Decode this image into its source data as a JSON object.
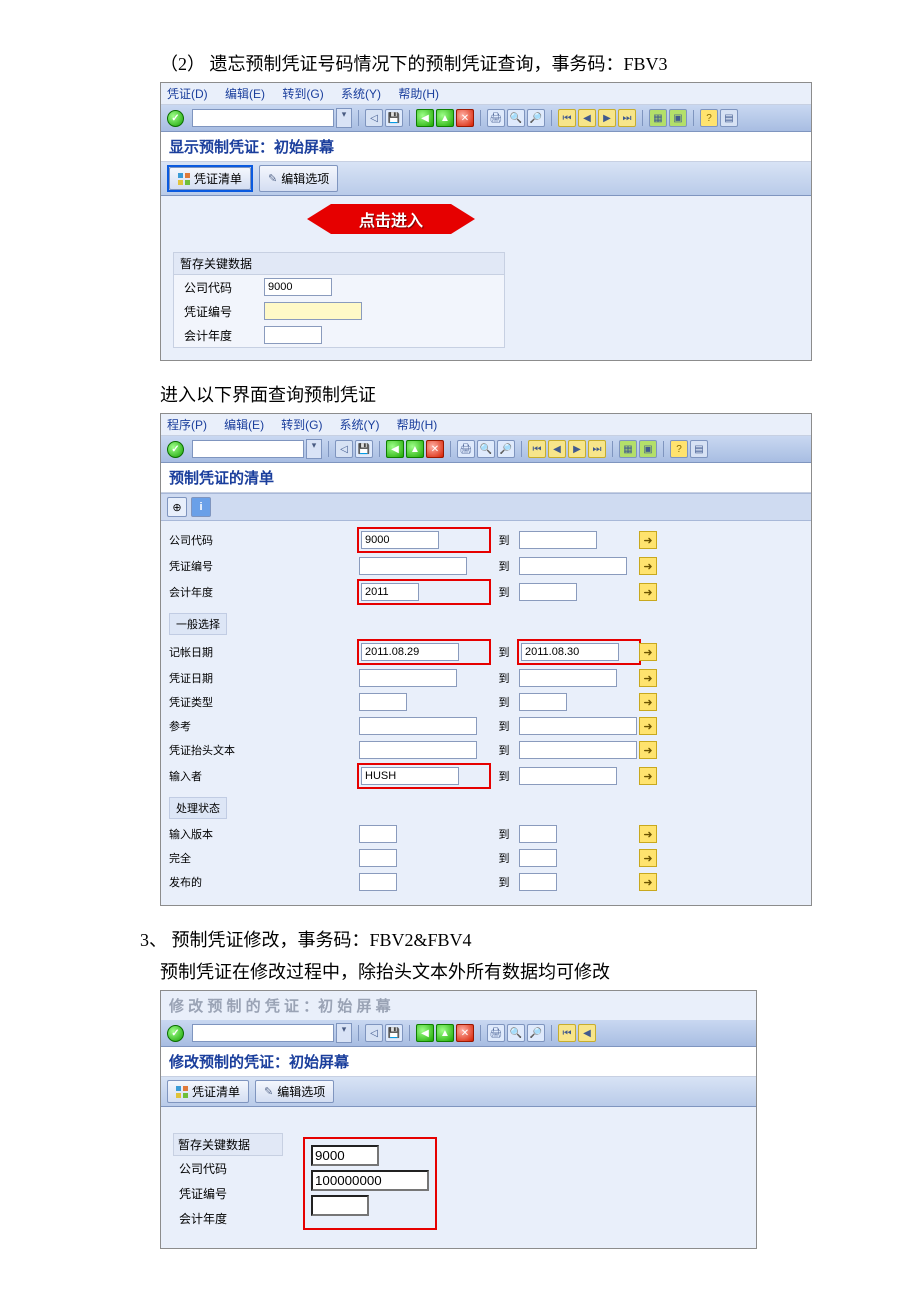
{
  "intro": {
    "item2": "（2） 遗忘预制凭证号码情况下的预制凭证查询，事务码：FBV3"
  },
  "screen1": {
    "menu": {
      "m1": "凭证(D)",
      "m2": "编辑(E)",
      "m3": "转到(G)",
      "m4": "系统(Y)",
      "m5": "帮助(H)"
    },
    "title": "显示预制凭证：初始屏幕",
    "btn_doclist": "凭证清单",
    "btn_editopts": "编辑选项",
    "callout": "点击进入",
    "group_title": "暂存关键数据",
    "lbl_bukrs": "公司代码",
    "lbl_belnr": "凭证编号",
    "lbl_gjahr": "会计年度",
    "val_bukrs": "9000",
    "val_belnr": "",
    "val_gjahr": ""
  },
  "midtext": "进入以下界面查询预制凭证",
  "screen2": {
    "menu": {
      "m1": "程序(P)",
      "m2": "编辑(E)",
      "m3": "转到(G)",
      "m4": "系统(Y)",
      "m5": "帮助(H)"
    },
    "title": "预制凭证的清单",
    "lbl_bukrs": "公司代码",
    "lbl_belnr": "凭证编号",
    "lbl_gjahr": "会计年度",
    "val_bukrs": "9000",
    "val_belnr": "",
    "val_gjahr": "2011",
    "to": "到",
    "grp_general": "一般选择",
    "lbl_budat": "记帐日期",
    "lbl_bldat": "凭证日期",
    "lbl_blart": "凭证类型",
    "lbl_ref": "参考",
    "lbl_htext": "凭证抬头文本",
    "lbl_enterer": "输入者",
    "val_budat_from": "2011.08.29",
    "val_budat_to": "2011.08.30",
    "val_enterer": "HUSH",
    "grp_status": "处理状态",
    "lbl_inpver": "输入版本",
    "lbl_complete": "完全",
    "lbl_released": "发布的"
  },
  "sec3": {
    "heading": "3、 预制凭证修改，事务码：FBV2&FBV4",
    "line2": "预制凭证在修改过程中，除抬头文本外所有数据均可修改"
  },
  "screen3": {
    "faded_title": "修 改 预 制 的 凭 证 ：初 始 屏 幕",
    "title": "修改预制的凭证：初始屏幕",
    "btn_doclist": "凭证清单",
    "btn_editopts": "编辑选项",
    "group_title": "暂存关键数据",
    "lbl_bukrs": "公司代码",
    "lbl_belnr": "凭证编号",
    "lbl_gjahr": "会计年度",
    "val_bukrs": "9000",
    "val_belnr": "100000000",
    "val_gjahr": ""
  }
}
